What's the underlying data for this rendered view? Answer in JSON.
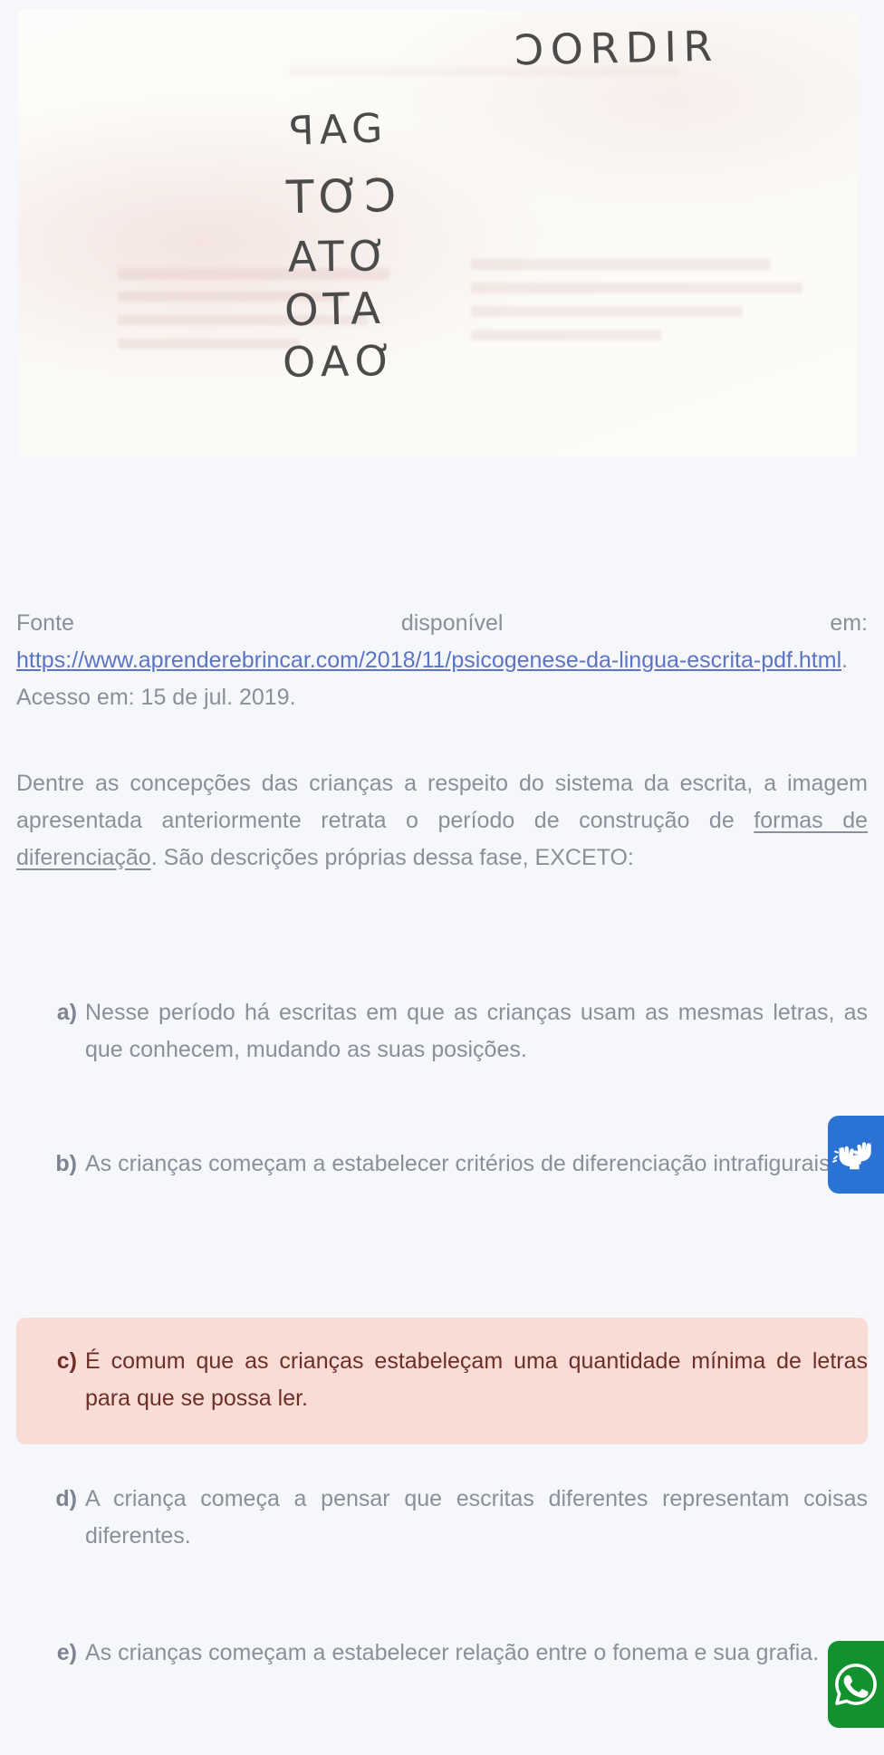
{
  "figure": {
    "alt_name": "child-handwriting-sample",
    "handwritten_lines": {
      "top_right_word": "ƆORDIR",
      "line1": "ꟼAG",
      "line2": "TƠƆ",
      "line3": "ATƠ",
      "line4": "OTA",
      "line5": "OAƠ"
    }
  },
  "source": {
    "line1_a": "Fonte",
    "line1_b": "disponível",
    "line1_c": "em:",
    "url": "https://www.aprenderebrincar.com/2018/11/psicogenese-da-lingua-escrita-pdf.html",
    "access": ". Acesso em: 15 de jul. 2019."
  },
  "question": {
    "part1": "Dentre as concepções das crianças a respeito do sistema da escrita, a imagem apresentada anteriormente retrata o período de construção de ",
    "emphasis": "formas de diferenciação",
    "part2": ". São descrições próprias dessa fase, EXCETO:"
  },
  "options": [
    {
      "marker": "a)",
      "text": "Nesse período há escritas em que as crianças usam as mesmas letras, as que conhecem, mudando as suas posições.",
      "highlighted": false
    },
    {
      "marker": "b)",
      "text": "As crianças começam a estabelecer critérios de diferenciação intrafigurais.",
      "highlighted": false
    },
    {
      "marker": "c)",
      "text": "É comum que as crianças estabeleçam uma quantidade mínima de letras para que se possa ler.",
      "highlighted": true
    },
    {
      "marker": "d)",
      "text": "A criança começa a pensar que escritas diferentes representam coisas diferentes.",
      "highlighted": false
    },
    {
      "marker": "e)",
      "text": "As crianças começam a estabelecer relação entre o fonema e sua grafia.",
      "highlighted": false
    }
  ],
  "widgets": {
    "vlibras": {
      "icon": "sign-language-hands-icon",
      "color": "#2a72d4"
    },
    "whatsapp": {
      "icon": "whatsapp-icon",
      "color": "#12922e"
    }
  },
  "colors": {
    "page_background": "#f6f7fb",
    "body_text": "#8b8f99",
    "link": "#5b74c4",
    "highlight_background": "#fadcd6",
    "highlight_text": "#6d2f28"
  }
}
